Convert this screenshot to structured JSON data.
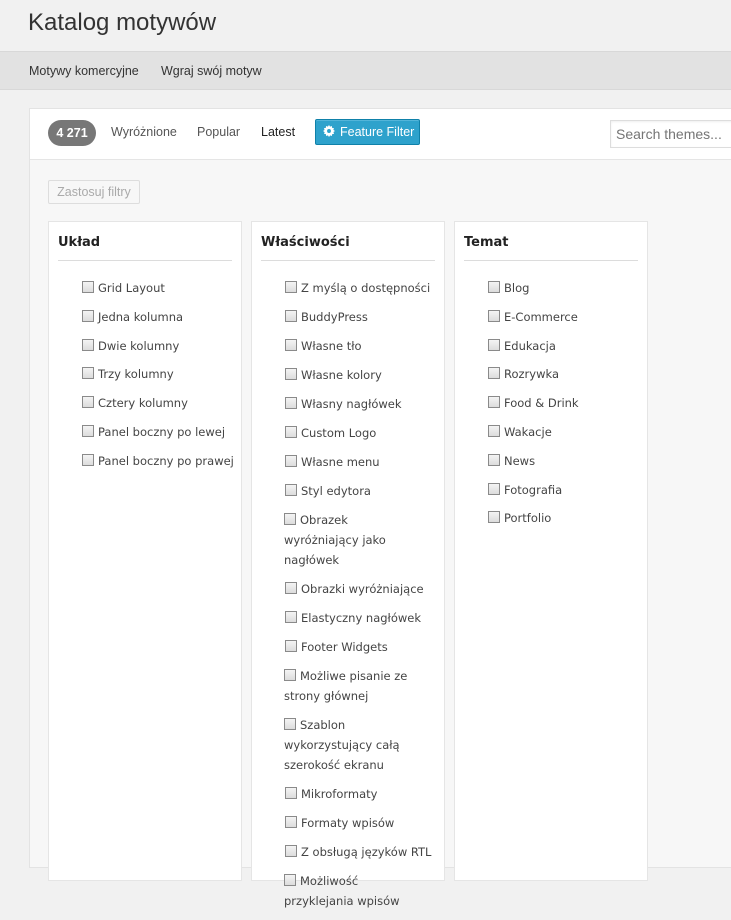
{
  "header": {
    "title": "Katalog motywów"
  },
  "subnav": {
    "items": [
      "Motywy komercyjne",
      "Wgraj swój motyw"
    ]
  },
  "filterbar": {
    "count": "4 271",
    "tabs": [
      "Wyróżnione",
      "Popular",
      "Latest"
    ],
    "active_tab": "Latest",
    "feature_filter_label": "Feature Filter",
    "search_placeholder": "Search themes..."
  },
  "apply_button": "Zastosuj filtry",
  "groups": [
    {
      "title": "Układ",
      "items": [
        "Grid Layout",
        "Jedna kolumna",
        "Dwie kolumny",
        "Trzy kolumny",
        "Cztery kolumny",
        "Panel boczny po lewej",
        "Panel boczny po prawej"
      ]
    },
    {
      "title": "Właściwości",
      "items": [
        "Z myślą o dostępności",
        "BuddyPress",
        "Własne tło",
        "Własne kolory",
        "Własny nagłówek",
        "Custom Logo",
        "Własne menu",
        "Styl edytora",
        "Obrazek wyróżniający jako nagłówek",
        "Obrazki wyróżniające",
        "Elastyczny nagłówek",
        "Footer Widgets",
        "Możliwe pisanie ze strony głównej",
        "Szablon wykorzystujący całą szerokość ekranu",
        "Mikroformaty",
        "Formaty wpisów",
        "Z obsługą języków RTL",
        "Możliwość przyklejania wpisów"
      ]
    },
    {
      "title": "Temat",
      "items": [
        "Blog",
        "E-Commerce",
        "Edukacja",
        "Rozrywka",
        "Food & Drink",
        "Wakacje",
        "News",
        "Fotografia",
        "Portfolio"
      ]
    }
  ]
}
